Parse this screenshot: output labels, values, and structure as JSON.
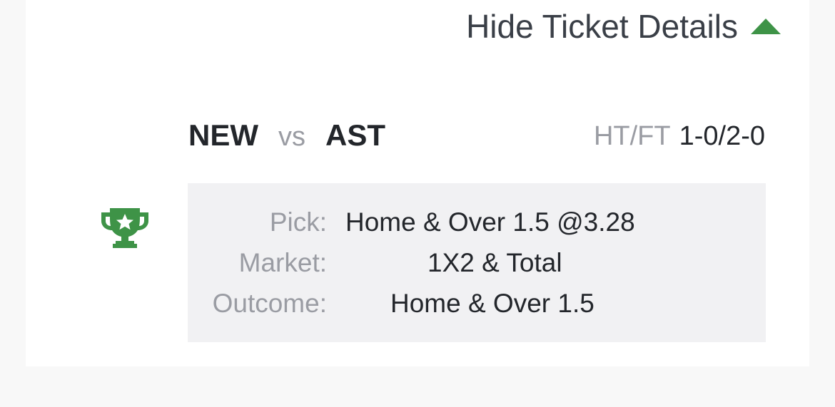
{
  "header": {
    "toggle_label": "Hide Ticket Details",
    "toggle_icon": "caret-up-icon",
    "accent_color": "#3e9347"
  },
  "match": {
    "home": "NEW",
    "vs": "vs",
    "away": "AST",
    "result_label": "HT/FT",
    "result_value": "1-0/2-0"
  },
  "status_icon": "trophy-icon",
  "details": {
    "pick_label": "Pick:",
    "pick_value": "Home & Over 1.5 @3.28",
    "market_label": "Market:",
    "market_value": "1X2 & Total",
    "outcome_label": "Outcome:",
    "outcome_value": "Home & Over 1.5"
  }
}
